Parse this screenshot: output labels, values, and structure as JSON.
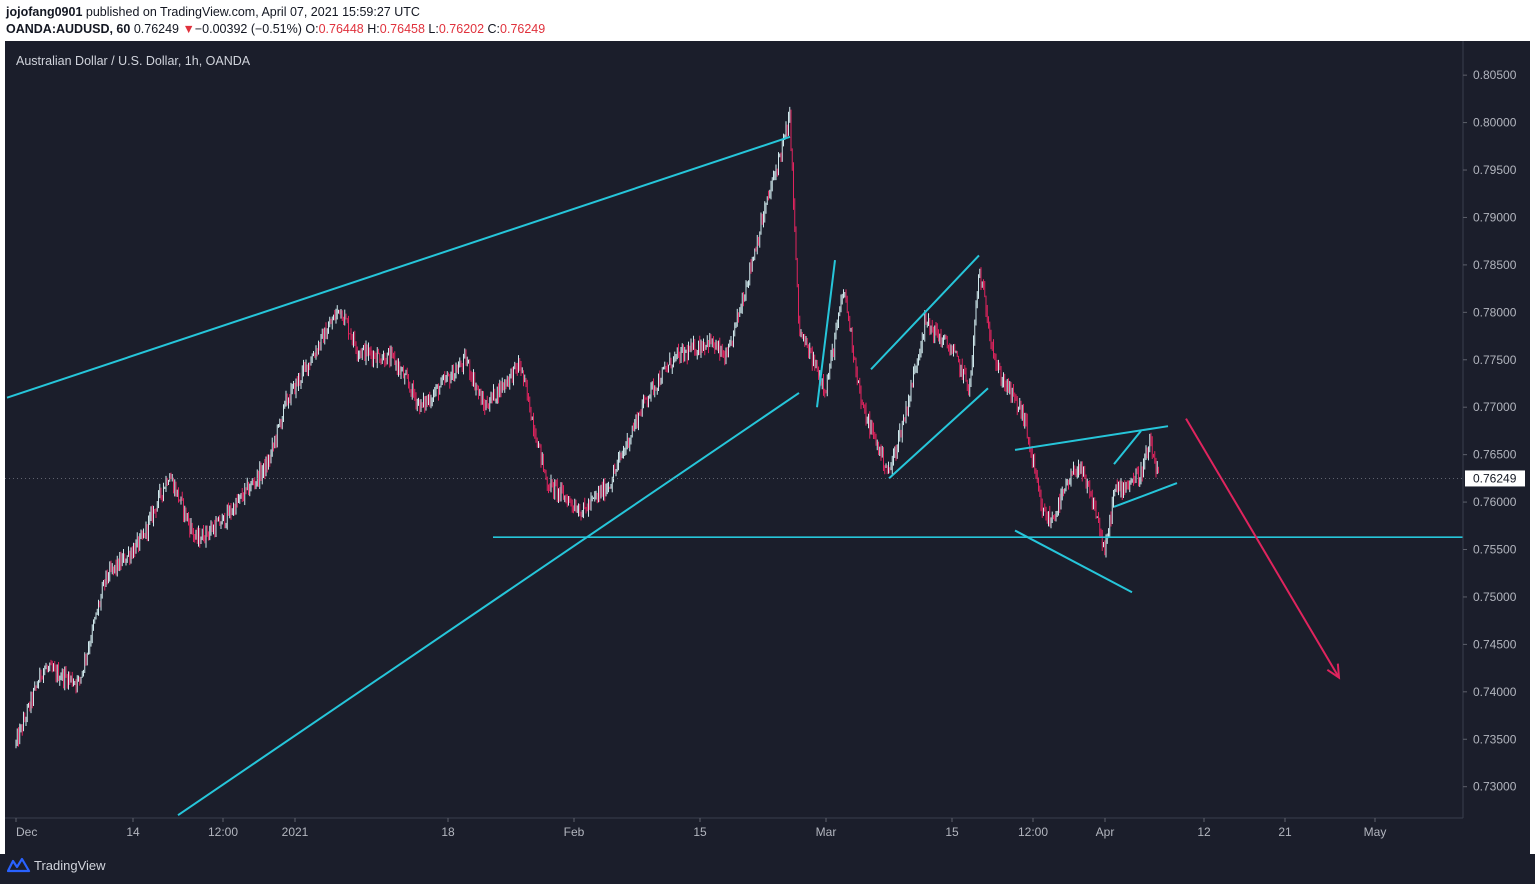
{
  "header": {
    "user": "jojofang0901",
    "published": " published on TradingView.com, April 07, 2021 15:59:27 UTC",
    "symbol": "OANDA:AUDUSD, 60",
    "last": "0.76249",
    "change_arrow": "▼",
    "change": "−0.00392 (−0.51%)",
    "o_label": "O:",
    "o_value": "0.76448",
    "h_label": "H:",
    "h_value": "0.76458",
    "l_label": "L:",
    "l_value": "0.76202",
    "c_label": "C:",
    "c_value": "0.76249"
  },
  "footer": {
    "brand": "TradingView",
    "logo_icon": "tradingview-logo-icon"
  },
  "colors": {
    "background": "#1b1e2b",
    "up": "#cfe8ec",
    "down": "#e0245e",
    "trendline": "#26c6da",
    "arrow": "#e0245e",
    "axis_text": "#b2b5be"
  },
  "chart_data": {
    "type": "candlestick",
    "title": "Australian Dollar / U.S. Dollar, 1h, OANDA",
    "current_price": 0.76249,
    "ylim": [
      0.7267,
      0.8086
    ],
    "y_ticks": [
      "0.80500",
      "0.80000",
      "0.79500",
      "0.79000",
      "0.78500",
      "0.78000",
      "0.77500",
      "0.77000",
      "0.76500",
      "0.76000",
      "0.75500",
      "0.75000",
      "0.74500",
      "0.74000",
      "0.73500",
      "0.73000"
    ],
    "x_ticks": [
      "Dec",
      "14",
      "12:00",
      "2021",
      "18",
      "Feb",
      "15",
      "Mar",
      "15",
      "12:00",
      "Apr",
      "12",
      "21",
      "May"
    ],
    "price_path": [
      {
        "date": "2020-12-01",
        "price": 0.7345
      },
      {
        "date": "2020-12-04",
        "price": 0.7425
      },
      {
        "date": "2020-12-08",
        "price": 0.741
      },
      {
        "date": "2020-12-11",
        "price": 0.752
      },
      {
        "date": "2020-12-15",
        "price": 0.756
      },
      {
        "date": "2020-12-18",
        "price": 0.763
      },
      {
        "date": "2020-12-21",
        "price": 0.756
      },
      {
        "date": "2020-12-24",
        "price": 0.758
      },
      {
        "date": "2020-12-29",
        "price": 0.764
      },
      {
        "date": "2020-12-31",
        "price": 0.7705
      },
      {
        "date": "2021-01-06",
        "price": 0.7805
      },
      {
        "date": "2021-01-08",
        "price": 0.776
      },
      {
        "date": "2021-01-12",
        "price": 0.775
      },
      {
        "date": "2021-01-15",
        "price": 0.77
      },
      {
        "date": "2021-01-20",
        "price": 0.775
      },
      {
        "date": "2021-01-22",
        "price": 0.77
      },
      {
        "date": "2021-01-26",
        "price": 0.7745
      },
      {
        "date": "2021-01-29",
        "price": 0.762
      },
      {
        "date": "2021-02-02",
        "price": 0.759
      },
      {
        "date": "2021-02-05",
        "price": 0.762
      },
      {
        "date": "2021-02-09",
        "price": 0.771
      },
      {
        "date": "2021-02-12",
        "price": 0.775
      },
      {
        "date": "2021-02-16",
        "price": 0.777
      },
      {
        "date": "2021-02-18",
        "price": 0.775
      },
      {
        "date": "2021-02-22",
        "price": 0.79
      },
      {
        "date": "2021-02-25",
        "price": 0.8005
      },
      {
        "date": "2021-02-26",
        "price": 0.778
      },
      {
        "date": "2021-03-01",
        "price": 0.772
      },
      {
        "date": "2021-03-03",
        "price": 0.7825
      },
      {
        "date": "2021-03-05",
        "price": 0.77
      },
      {
        "date": "2021-03-08",
        "price": 0.763
      },
      {
        "date": "2021-03-10",
        "price": 0.77
      },
      {
        "date": "2021-03-12",
        "price": 0.779
      },
      {
        "date": "2021-03-15",
        "price": 0.776
      },
      {
        "date": "2021-03-17",
        "price": 0.772
      },
      {
        "date": "2021-03-18",
        "price": 0.7845
      },
      {
        "date": "2021-03-20",
        "price": 0.774
      },
      {
        "date": "2021-03-23",
        "price": 0.769
      },
      {
        "date": "2021-03-25",
        "price": 0.759
      },
      {
        "date": "2021-03-26",
        "price": 0.758
      },
      {
        "date": "2021-03-29",
        "price": 0.764
      },
      {
        "date": "2021-03-31",
        "price": 0.759
      },
      {
        "date": "2021-04-01",
        "price": 0.7545
      },
      {
        "date": "2021-04-02",
        "price": 0.761
      },
      {
        "date": "2021-04-05",
        "price": 0.763
      },
      {
        "date": "2021-04-06",
        "price": 0.766
      },
      {
        "date": "2021-04-07",
        "price": 0.7625
      }
    ],
    "annotations": [
      {
        "type": "trendline",
        "from": [
          "2020-11-30",
          0.771
        ],
        "to": [
          "2021-02-25",
          0.7985
        ]
      },
      {
        "type": "trendline",
        "from": [
          "2020-12-19",
          0.727
        ],
        "to": [
          "2021-02-26",
          0.7715
        ]
      },
      {
        "type": "horizontal",
        "price": 0.7563,
        "from": "2021-01-23"
      },
      {
        "type": "trendline",
        "from": [
          "2021-02-28",
          0.77
        ],
        "to": [
          "2021-03-02",
          0.7855
        ]
      },
      {
        "type": "trendline",
        "from": [
          "2021-03-06",
          0.774
        ],
        "to": [
          "2021-03-18",
          0.786
        ]
      },
      {
        "type": "trendline",
        "from": [
          "2021-03-08",
          0.7625
        ],
        "to": [
          "2021-03-19",
          0.772
        ]
      },
      {
        "type": "trendline",
        "from": [
          "2021-03-22",
          0.7655
        ],
        "to": [
          "2021-04-08",
          0.768
        ]
      },
      {
        "type": "trendline",
        "from": [
          "2021-03-22",
          0.757
        ],
        "to": [
          "2021-04-04",
          0.7505
        ]
      },
      {
        "type": "trendline",
        "from": [
          "2021-04-02",
          0.764
        ],
        "to": [
          "2021-04-05",
          0.7675
        ]
      },
      {
        "type": "trendline",
        "from": [
          "2021-04-02",
          0.7595
        ],
        "to": [
          "2021-04-09",
          0.762
        ]
      },
      {
        "type": "arrow",
        "from": [
          "2021-04-10",
          0.7688
        ],
        "to": [
          "2021-04-27",
          0.7415
        ]
      }
    ]
  }
}
